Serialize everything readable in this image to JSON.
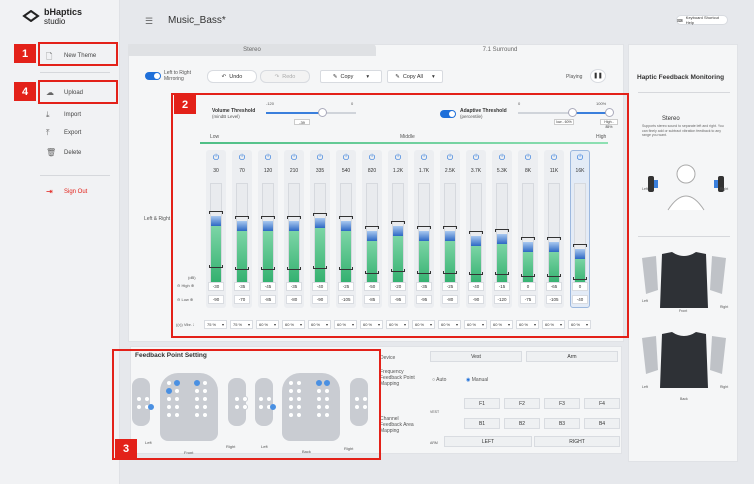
{
  "app": {
    "logo_line1": "bHaptics",
    "logo_line2": "studio",
    "title": "Music_Bass*",
    "shortcut_help": "Keyboard Shortcut Help"
  },
  "sidebar": {
    "items": [
      {
        "label": "New Theme",
        "icon": "new-file-icon"
      },
      {
        "label": "Upload",
        "icon": "cloud-upload-icon"
      },
      {
        "label": "Import",
        "icon": "import-icon"
      },
      {
        "label": "Export",
        "icon": "export-icon"
      },
      {
        "label": "Delete",
        "icon": "trash-icon"
      },
      {
        "label": "Sign Out",
        "icon": "sign-out-icon"
      }
    ]
  },
  "tabs": [
    "Stereo",
    "7.1 Surround"
  ],
  "toolbar": {
    "mirroring": "Left to Right\nMirroring",
    "undo": "Undo",
    "redo": "Redo",
    "copy": "Copy",
    "copy_all": "Copy All",
    "playing": "Playing"
  },
  "volume_threshold": {
    "label": "Volume Threshold",
    "sub": "(mindB Level)",
    "min": "-120",
    "max": "0",
    "value": "-39",
    "fraction": 0.62
  },
  "adaptive_threshold": {
    "label": "Adaptive Threshold",
    "sub": "(percentile)",
    "min": "0",
    "max": "100%",
    "low": "low - 60%",
    "high": "High - 85%",
    "low_fraction": 0.6,
    "high_fraction": 0.85
  },
  "bands_header": {
    "low": "Low",
    "middle": "Middle",
    "high": "High"
  },
  "row_label": "Left & Right",
  "db_label": "(dB)",
  "high_label": "High",
  "low_label": "Low",
  "vib_label": "Vibr.",
  "bands": [
    {
      "freq": "30",
      "high": "-30",
      "low": "-90",
      "fill": 0.6
    },
    {
      "freq": "70",
      "high": "-35",
      "low": "-70",
      "fill": 0.55
    },
    {
      "freq": "120",
      "high": "-45",
      "low": "-85",
      "fill": 0.55
    },
    {
      "freq": "210",
      "high": "-35",
      "low": "-80",
      "fill": 0.55
    },
    {
      "freq": "335",
      "high": "-40",
      "low": "-90",
      "fill": 0.58
    },
    {
      "freq": "540",
      "high": "-25",
      "low": "-105",
      "fill": 0.55
    },
    {
      "freq": "820",
      "high": "-50",
      "low": "-85",
      "fill": 0.45
    },
    {
      "freq": "1.2K",
      "high": "-20",
      "low": "-95",
      "fill": 0.5
    },
    {
      "freq": "1.7K",
      "high": "-35",
      "low": "-95",
      "fill": 0.45
    },
    {
      "freq": "2.5K",
      "high": "-25",
      "low": "-80",
      "fill": 0.45
    },
    {
      "freq": "3.7K",
      "high": "-40",
      "low": "-90",
      "fill": 0.4
    },
    {
      "freq": "5.3K",
      "high": "-15",
      "low": "-120",
      "fill": 0.42
    },
    {
      "freq": "8K",
      "high": "0",
      "low": "-75",
      "fill": 0.35
    },
    {
      "freq": "11K",
      "high": "-65",
      "low": "-105",
      "fill": 0.35
    },
    {
      "freq": "16K",
      "high": "0",
      "low": "-40",
      "fill": 0.28
    }
  ],
  "vib_values": [
    "75 %",
    "75 %",
    "60 %",
    "60 %",
    "60 %",
    "60 %",
    "60 %",
    "60 %",
    "60 %",
    "60 %",
    "60 %",
    "60 %",
    "60 %",
    "60 %",
    "60 %"
  ],
  "feedback": {
    "title": "Feedback Point Setting",
    "left": "Left",
    "right": "Right",
    "front": "Front",
    "back": "Back"
  },
  "mapping": {
    "device": "Device",
    "vest": "Vest",
    "arm": "Arm",
    "freq_mapping": "Frequency\nFeedback Point\nMapping",
    "auto": "Auto",
    "manual": "Manual",
    "vest_small": "VEST",
    "f_buttons": [
      "F1",
      "F2",
      "F3",
      "F4"
    ],
    "b_buttons": [
      "B1",
      "B2",
      "B3",
      "B4"
    ],
    "channel_mapping": "Channel\nFeedback Area\nMapping",
    "arm_small": "ARM",
    "left_btn": "LEFT",
    "right_btn": "RIGHT"
  },
  "monitor": {
    "title": "Haptic Feedback Monitoring",
    "mode": "Stereo",
    "desc": "Supports stereo sound to separate left and right. You can finely add or subtract vibration feedback to any range you want.",
    "left": "Left",
    "right": "Right",
    "front": "Front",
    "back": "Back"
  },
  "markers": [
    "1",
    "2",
    "3",
    "4"
  ]
}
